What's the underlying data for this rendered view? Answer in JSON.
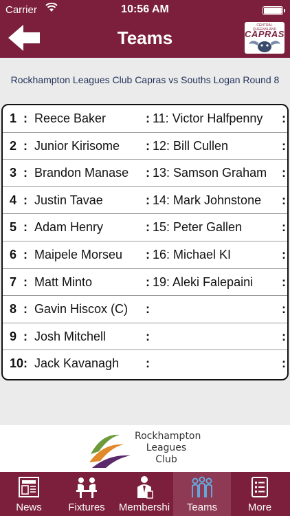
{
  "status_bar": {
    "carrier": "Carrier",
    "time": "10:56 AM"
  },
  "header": {
    "title": "Teams"
  },
  "logo": {
    "tag": "CENTRAL QUEENSLAND",
    "name": "CAPRAS"
  },
  "match": {
    "title": "Rockhampton Leagues Club Capras vs Souths Logan Round 8"
  },
  "teams": {
    "rows": [
      {
        "num": "1",
        "player": "Reece Baker",
        "right": "11: Victor Halfpenny"
      },
      {
        "num": "2",
        "player": "Junior Kirisome",
        "right": "12: Bill Cullen"
      },
      {
        "num": "3",
        "player": "Brandon Manase",
        "right": "13: Samson Graham"
      },
      {
        "num": "4",
        "player": "Justin Tavae",
        "right": "14: Mark Johnstone"
      },
      {
        "num": "5",
        "player": "Adam Henry",
        "right": "15: Peter Gallen"
      },
      {
        "num": "6",
        "player": "Maipele Morseu",
        "right": "16: Michael KI"
      },
      {
        "num": "7",
        "player": "Matt Minto",
        "right": "19: Aleki Falepaini"
      },
      {
        "num": "8",
        "player": "Gavin Hiscox (C)",
        "right": ""
      },
      {
        "num": "9",
        "player": "Josh Mitchell",
        "right": ""
      },
      {
        "num": "10",
        "player": "Jack Kavanagh",
        "right": ""
      }
    ]
  },
  "club": {
    "line1": "Rockhampton",
    "line2": "Leagues",
    "line3": "Club"
  },
  "tabs": [
    {
      "label": "News",
      "icon": "newspaper-icon"
    },
    {
      "label": "Fixtures",
      "icon": "fixtures-icon"
    },
    {
      "label": "Membershi",
      "icon": "membership-icon"
    },
    {
      "label": "Teams",
      "icon": "teams-icon"
    },
    {
      "label": "More",
      "icon": "more-list-icon"
    }
  ],
  "colors": {
    "primary": "#7b1f3c",
    "tab_active": "#8e3a54",
    "background": "#ebebeb",
    "subtitle": "#23325a"
  }
}
